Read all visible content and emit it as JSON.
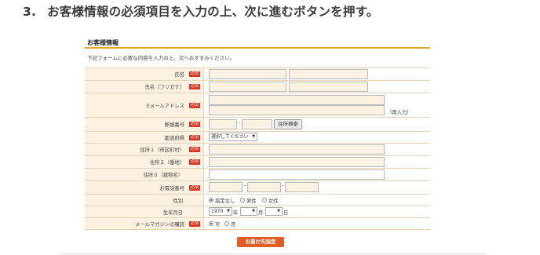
{
  "heading": {
    "step": "3.",
    "text": "お客様情報の必須項目を入力の上、次に進むボタンを押す。"
  },
  "form": {
    "section_title": "お客様情報",
    "intro": "下記フォームに必要な内容を入力の上、次へおすすみください。",
    "required_badge": "必須",
    "labels": {
      "name": "氏名",
      "kana": "氏名（フリガナ）",
      "email": "Eメールアドレス",
      "zip": "郵便番号",
      "pref": "都道府県",
      "addr1": "住所１（市区町村）",
      "addr2": "住所２（番地）",
      "addr3": "住所３（建物名）",
      "phone": "お電話番号",
      "gender": "性別",
      "birth": "生年月日",
      "newsletter": "メールマガジンの購読"
    },
    "email_confirm_note": "（再入力）",
    "zip_sep": "-",
    "phone_sep": "-",
    "zip_search_button": "住所検索",
    "pref_select": "選択してください",
    "gender_options": [
      "指定なし",
      "男性",
      "女性"
    ],
    "birth": {
      "year": "1970",
      "year_unit": "年",
      "month": "",
      "month_unit": "月",
      "day": "",
      "day_unit": "日"
    },
    "newsletter_options": [
      "可",
      "否"
    ],
    "submit": "お届け先指定"
  }
}
